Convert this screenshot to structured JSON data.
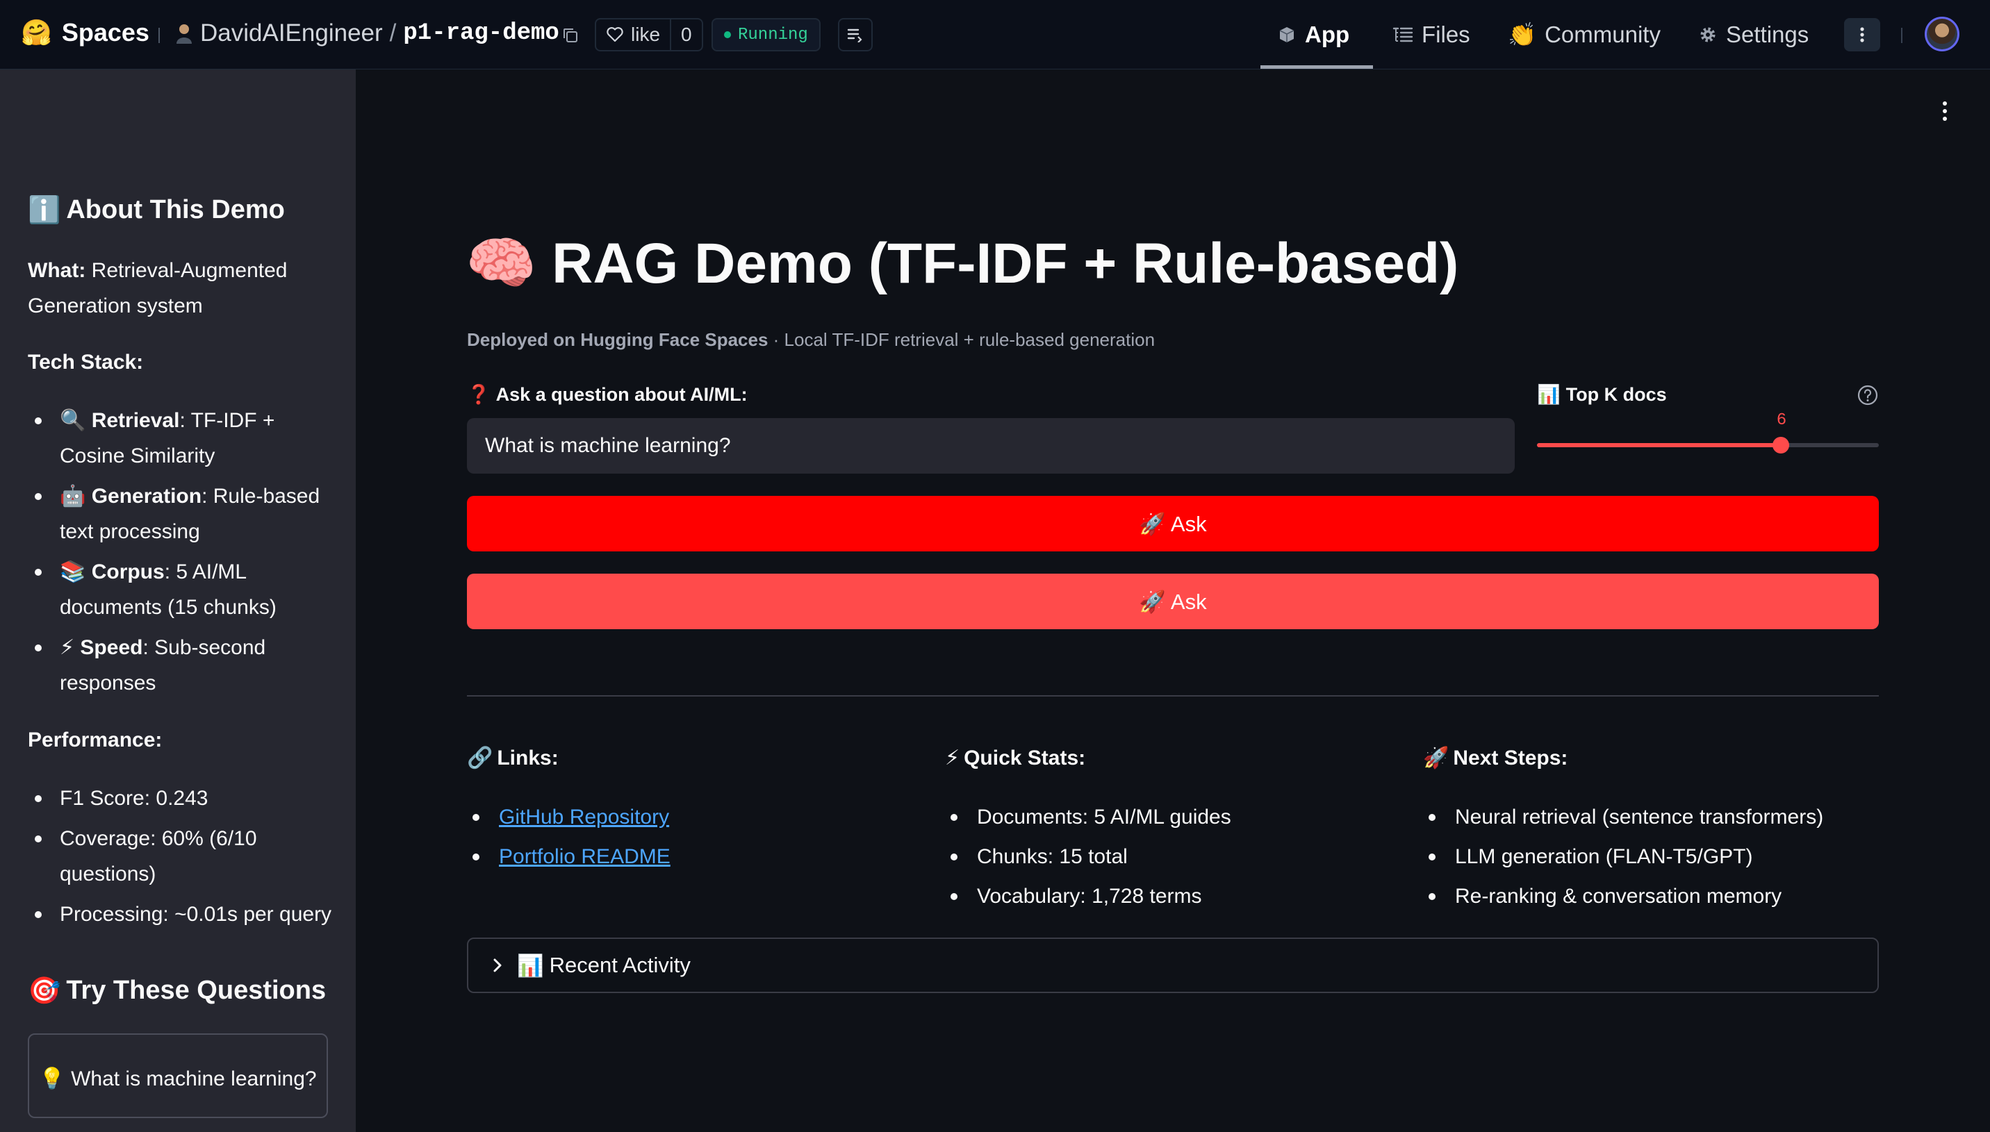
{
  "topbar": {
    "brand_emoji": "🤗",
    "brand": "Spaces",
    "owner": "DavidAIEngineer",
    "separator": "/",
    "repo": "p1-rag-demo",
    "like_label": "like",
    "like_count": "0",
    "status": "Running",
    "nav": [
      {
        "icon": "cube-icon",
        "label": "App",
        "active": true
      },
      {
        "icon": "files-icon",
        "label": "Files",
        "active": false
      },
      {
        "icon": "community-icon",
        "label": "Community",
        "active": false
      },
      {
        "icon": "gear-icon",
        "label": "Settings",
        "active": false
      }
    ],
    "community_emoji": "👏"
  },
  "sidebar": {
    "about_emoji": "ℹ️",
    "about_title": "About This Demo",
    "what_label": "What:",
    "what_text": " Retrieval-Augmented Generation system",
    "tech_title": "Tech Stack:",
    "tech": [
      {
        "emoji": "🔍",
        "label": "Retrieval",
        "text": ": TF-IDF + Cosine Similarity"
      },
      {
        "emoji": "🤖",
        "label": "Generation",
        "text": ": Rule-based text processing"
      },
      {
        "emoji": "📚",
        "label": "Corpus",
        "text": ": 5 AI/ML documents (15 chunks)"
      },
      {
        "emoji": "⚡",
        "label": "Speed",
        "text": ": Sub-second responses"
      }
    ],
    "perf_title": "Performance:",
    "perf": [
      "F1 Score: 0.243",
      "Coverage: 60% (6/10 questions)",
      "Processing: ~0.01s per query"
    ],
    "try_emoji": "🎯",
    "try_title": "Try These Questions",
    "question_button": "💡 What is machine learning?"
  },
  "main": {
    "title_emoji": "🧠",
    "title": "RAG Demo (TF-IDF + Rule-based)",
    "subtitle_bold": "Deployed on Hugging Face Spaces",
    "subtitle_rest": " · Local TF-IDF retrieval + rule-based generation",
    "question_emoji": "❓",
    "question_label": "Ask a question about AI/ML:",
    "question_value": "What is machine learning?",
    "topk_emoji": "📊",
    "topk_label": "Top K docs",
    "topk_value": "6",
    "topk_fraction": 0.714,
    "ask_primary": "🚀 Ask",
    "ask_secondary": "🚀 Ask",
    "links_emoji": "🔗",
    "links_title": "Links:",
    "links": [
      "GitHub Repository",
      "Portfolio README"
    ],
    "stats_emoji": "⚡",
    "stats_title": "Quick Stats:",
    "stats": [
      "Documents: 5 AI/ML guides",
      "Chunks: 15 total",
      "Vocabulary: 1,728 terms"
    ],
    "next_emoji": "🚀",
    "next_title": "Next Steps:",
    "next": [
      "Neural retrieval (sentence transformers)",
      "LLM generation (FLAN-T5/GPT)",
      "Re-ranking & conversation memory"
    ],
    "recent_emoji": "📊",
    "recent_label": "Recent Activity"
  },
  "colors": {
    "accent": "#ff4b4b",
    "primary_button": "#ff0000",
    "link": "#4da6ff",
    "running": "#10b981"
  }
}
